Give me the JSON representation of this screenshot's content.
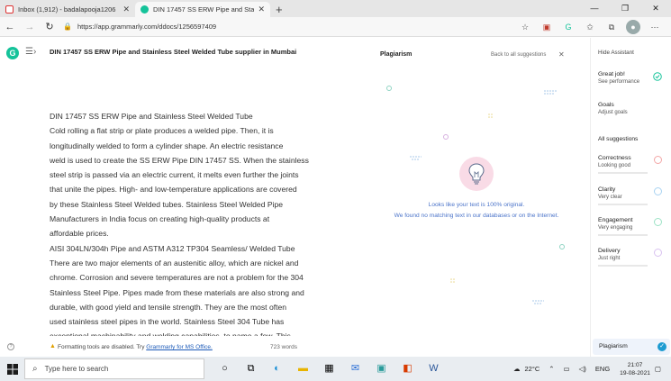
{
  "browser": {
    "tabs": [
      {
        "label": "Inbox (1,912) - badalapooja1206",
        "active": false
      },
      {
        "label": "DIN 17457 SS ERW Pipe and Stai",
        "active": true
      }
    ],
    "url": "https://app.grammarly.com/ddocs/1256597409"
  },
  "document": {
    "title": "DIN 17457 SS ERW Pipe and Stainless Steel Welded Tube supplier in Mumbai",
    "lines": [
      "DIN 17457 SS ERW Pipe and Stainless Steel Welded Tube",
      "Cold rolling a flat strip or plate produces a welded pipe. Then, it is",
      "longitudinally welded to form a cylinder shape. An electric resistance",
      "weld is used to create the SS ERW Pipe DIN 17457 SS. When the stainless",
      "steel strip is passed via an electric current, it melts even further the joints",
      "that unite the pipes. High- and low-temperature applications are covered",
      "by these Stainless Steel Welded tubes. Stainless Steel Welded Pipe",
      "Manufacturers in India focus on creating high-quality products at",
      "affordable prices.",
      "AISI 304LN/304h Pipe and ASTM A312 TP304 Seamless/ Welded Tube",
      "There are two major elements of an austenitic alloy, which are nickel and",
      "chrome. Corrosion and severe temperatures are not a problem for the 304",
      "Stainless Steel Pipe. Pipes made from these materials are also strong and",
      "durable, with good yield and tensile strength. They are the most often",
      "used stainless steel pipes in the world. Stainless Steel 304 Tube has",
      "exceptional machinability and welding capabilities, to name a few. This"
    ]
  },
  "footer": {
    "formatting_text": "Formatting tools are disabled. Try ",
    "link_text": "Grammarly for MS Office.",
    "word_count": "723 words"
  },
  "plagiarism": {
    "title": "Plagiarism",
    "back_label": "Back to all suggestions",
    "message1": "Looks like your text is 100% original.",
    "message2": "We found no matching text in our databases or on the Internet."
  },
  "sidebar": {
    "hide_label": "Hide Assistant",
    "performance": {
      "title": "Great job!",
      "subtitle": "See performance"
    },
    "goals": {
      "title": "Goals",
      "subtitle": "Adjust goals"
    },
    "all_label": "All suggestions",
    "categories": [
      {
        "title": "Correctness",
        "subtitle": "Looking good",
        "color": "#f3a6a6"
      },
      {
        "title": "Clarity",
        "subtitle": "Very clear",
        "color": "#a9d3f2"
      },
      {
        "title": "Engagement",
        "subtitle": "Very engaging",
        "color": "#9de3c6"
      },
      {
        "title": "Delivery",
        "subtitle": "Just right",
        "color": "#d9c2f0"
      }
    ],
    "plagiarism_label": "Plagiarism"
  },
  "taskbar": {
    "search_placeholder": "Type here to search",
    "temperature": "22°C",
    "language": "ENG",
    "time": "21:07",
    "date": "19-08-2021"
  },
  "colors": {
    "accent": "#15c39a",
    "link": "#4a73c9"
  }
}
